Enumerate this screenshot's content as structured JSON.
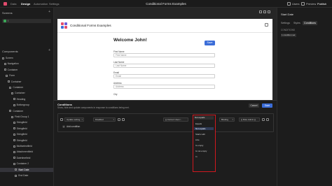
{
  "topbar": {
    "tabs": [
      "Data",
      "Design",
      "Automation",
      "Settings"
    ],
    "active_tab": "Design",
    "app_title": "Conditional Forms Examples",
    "users_label": "Users",
    "preview_label": "Preview",
    "publish_label": "Publish"
  },
  "left_panel": {
    "screens_heading": "Screens",
    "screen_item": "/",
    "components_heading": "Components",
    "tree": [
      {
        "label": "Screen",
        "depth": 0
      },
      {
        "label": "Navigation",
        "depth": 1
      },
      {
        "label": "Container",
        "depth": 1
      },
      {
        "label": "Form",
        "depth": 2
      },
      {
        "label": "Container",
        "depth": 3
      },
      {
        "label": "Container",
        "depth": 4
      },
      {
        "label": "Container",
        "depth": 5
      },
      {
        "label": "Heading",
        "depth": 6
      },
      {
        "label": "Buttongroup",
        "depth": 6
      },
      {
        "label": "Container",
        "depth": 4
      },
      {
        "label": "Field Group 1",
        "depth": 5
      },
      {
        "label": "Stringfield",
        "depth": 6
      },
      {
        "label": "Stringfield",
        "depth": 6
      },
      {
        "label": "Stringfield",
        "depth": 6
      },
      {
        "label": "Stringfield",
        "depth": 6
      },
      {
        "label": "Multiselectfield",
        "depth": 6
      },
      {
        "label": "Attachmentfield",
        "depth": 6
      },
      {
        "label": "Datetimefield",
        "depth": 6
      },
      {
        "label": "Container 2",
        "depth": 6
      },
      {
        "label": "Start Date",
        "depth": 7,
        "selected": true
      },
      {
        "label": "End Date",
        "depth": 7
      }
    ]
  },
  "preview": {
    "app_name": "Conditional Forms Examples",
    "heading": "Welcome John!",
    "save_label": "Save",
    "fields": [
      {
        "label": "First Name",
        "placeholder": "First Name"
      },
      {
        "label": "Last Name",
        "placeholder": "Last Name"
      },
      {
        "label": "Email",
        "placeholder": "Email"
      },
      {
        "label": "Address",
        "placeholder": "Address"
      },
      {
        "label": "City",
        "placeholder": ""
      }
    ]
  },
  "right_panel": {
    "title": "Start Date",
    "tabs": [
      "Settings",
      "Styles",
      "Conditions"
    ],
    "active_tab": "Conditions",
    "section_label": "CONDITIONS",
    "condition_count": "1 condition set"
  },
  "conditions": {
    "title": "Conditions",
    "subtitle": "Show, hide and update components in response to conditions being met.",
    "cancel_label": "Cancel",
    "save_label": "Save",
    "rule": {
      "action": "Update setting",
      "setting": "Disabled",
      "value_tag": "TO",
      "lhs": "{{ Current User.r...",
      "operator": "Not equals",
      "type": "Binding",
      "rhs": "{{ Role.Admin }}"
    },
    "add_label": "Add condition"
  },
  "operator_dropdown": {
    "selected": "Not equals",
    "options": [
      "Equals",
      "Not equals",
      "Starts with",
      "Like",
      "Is empty",
      "Is not empty",
      "In"
    ],
    "highlighted": "Not equals",
    "highlight_color": "#d0181f"
  }
}
